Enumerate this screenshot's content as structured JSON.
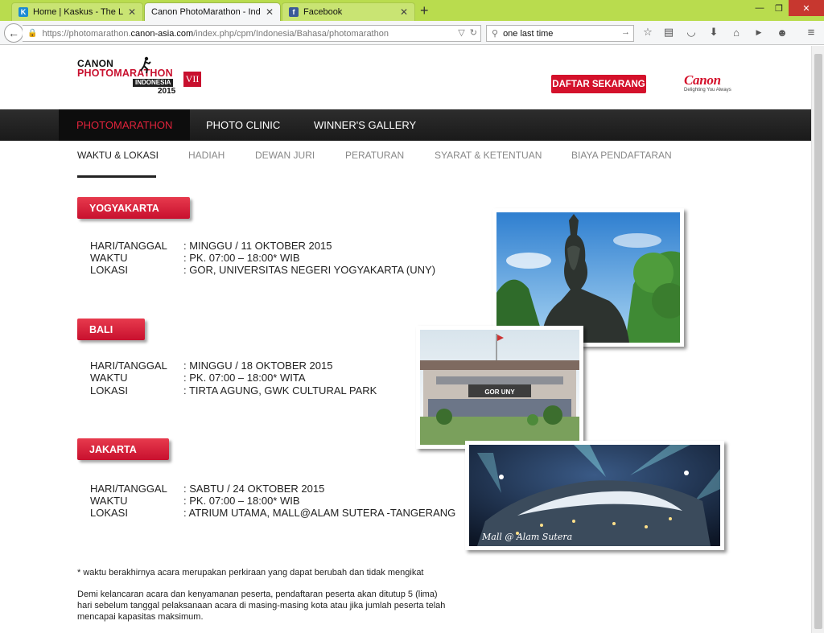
{
  "browser": {
    "tabs": [
      {
        "title": "Home | Kaskus - The Larg...",
        "favicon": "kaskus-favicon"
      },
      {
        "title": "Canon PhotoMarathon - Indo...",
        "favicon": "canon-favicon"
      },
      {
        "title": "Facebook",
        "favicon": "facebook-favicon"
      }
    ],
    "new_tab": "+",
    "url_prefix": "https://photomarathon.",
    "url_domain": "canon-asia.com",
    "url_path": "/index.php/cpm/Indonesia/Bahasa/photomarathon",
    "search_value": "one last time"
  },
  "header": {
    "logo_line1": "CANON",
    "logo_line2": "PHOTOMARATHON",
    "logo_line3": "INDONESIA",
    "logo_year": "2015",
    "logo_badge": "VII",
    "cta_label": "DAFTAR SEKARANG",
    "brand_name": "Canon",
    "brand_tagline": "Delighting You Always"
  },
  "main_nav": [
    "PHOTOMARATHON",
    "PHOTO CLINIC",
    "WINNER'S GALLERY"
  ],
  "sub_nav": [
    "WAKTU & LOKASI",
    "HADIAH",
    "DEWAN JURI",
    "PERATURAN",
    "SYARAT & KETENTUAN",
    "BIAYA PENDAFTARAN"
  ],
  "events": [
    {
      "city": "YOGYAKARTA",
      "rows": [
        {
          "label": "HARI/TANGGAL",
          "value": ": MINGGU / 11 OKTOBER 2015"
        },
        {
          "label": "WAKTU",
          "value": ": PK. 07:00 – 18:00* WIB"
        },
        {
          "label": "LOKASI",
          "value": ": GOR, UNIVERSITAS NEGERI YOGYAKARTA (UNY)"
        }
      ]
    },
    {
      "city": "BALI",
      "rows": [
        {
          "label": "HARI/TANGGAL",
          "value": ": MINGGU / 18 OKTOBER 2015"
        },
        {
          "label": "WAKTU",
          "value": ": PK. 07:00 – 18:00* WITA"
        },
        {
          "label": "LOKASI",
          "value": ": TIRTA AGUNG, GWK CULTURAL PARK"
        }
      ]
    },
    {
      "city": "JAKARTA",
      "rows": [
        {
          "label": "HARI/TANGGAL",
          "value": ": SABTU / 24 OKTOBER 2015"
        },
        {
          "label": "WAKTU",
          "value": ": PK. 07:00 – 18:00* WIB"
        },
        {
          "label": "LOKASI",
          "value": ": ATRIUM UTAMA, MALL@ALAM SUTERA -TANGERANG"
        }
      ]
    }
  ],
  "notes": {
    "footnote": "* waktu berakhirnya acara merupakan perkiraan yang dapat berubah dan tidak mengikat",
    "para_line1": "Demi kelancaran acara dan kenyamanan peserta, pendaftaran peserta akan ditutup 5 (lima)",
    "para_line2": "hari sebelum tanggal pelaksanaan acara di masing-masing kota atau jika jumlah peserta telah",
    "para_line3": "mencapai kapasitas maksimum."
  },
  "photos": {
    "gor_sign": "GOR UNY",
    "mall_caption": "Mall @ Alam Sutera"
  }
}
